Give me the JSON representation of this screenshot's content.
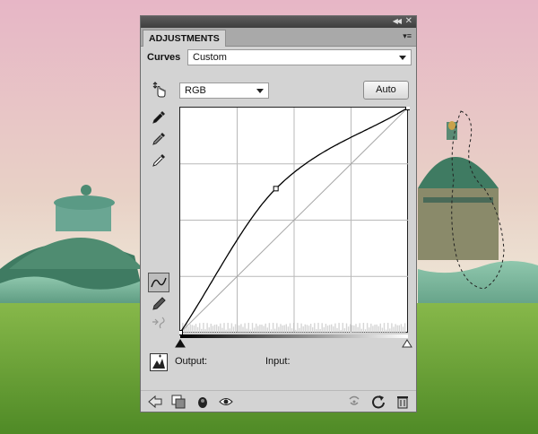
{
  "panel": {
    "tab_label": "ADJUSTMENTS",
    "adjustment_name": "Curves",
    "preset": "Custom",
    "channel": "RGB",
    "auto_label": "Auto",
    "output_label": "Output:",
    "input_label": "Input:"
  },
  "icons": {
    "top_tools": [
      "targeted-adjustment-icon",
      "black-point-eyedropper-icon",
      "gray-point-eyedropper-icon",
      "white-point-eyedropper-icon"
    ],
    "side_tools": [
      "curve-points-icon",
      "pencil-icon",
      "smooth-curve-icon"
    ],
    "bottom_bar": [
      "return-arrow-icon",
      "clip-to-layer-icon",
      "layer-visibility-toggle-icon",
      "view-previous-icon",
      "reset-icon",
      "delete-icon"
    ]
  },
  "curve": {
    "points": [
      [
        0,
        0
      ],
      [
        42,
        64
      ],
      [
        100,
        100
      ]
    ]
  },
  "colors": {
    "titlebar": "#4a4a4a",
    "panel_bg": "#d3d3d3",
    "sky_top": "#e8b9c7",
    "grass": "#6fa33a",
    "dome_green": "#3f7b62"
  }
}
